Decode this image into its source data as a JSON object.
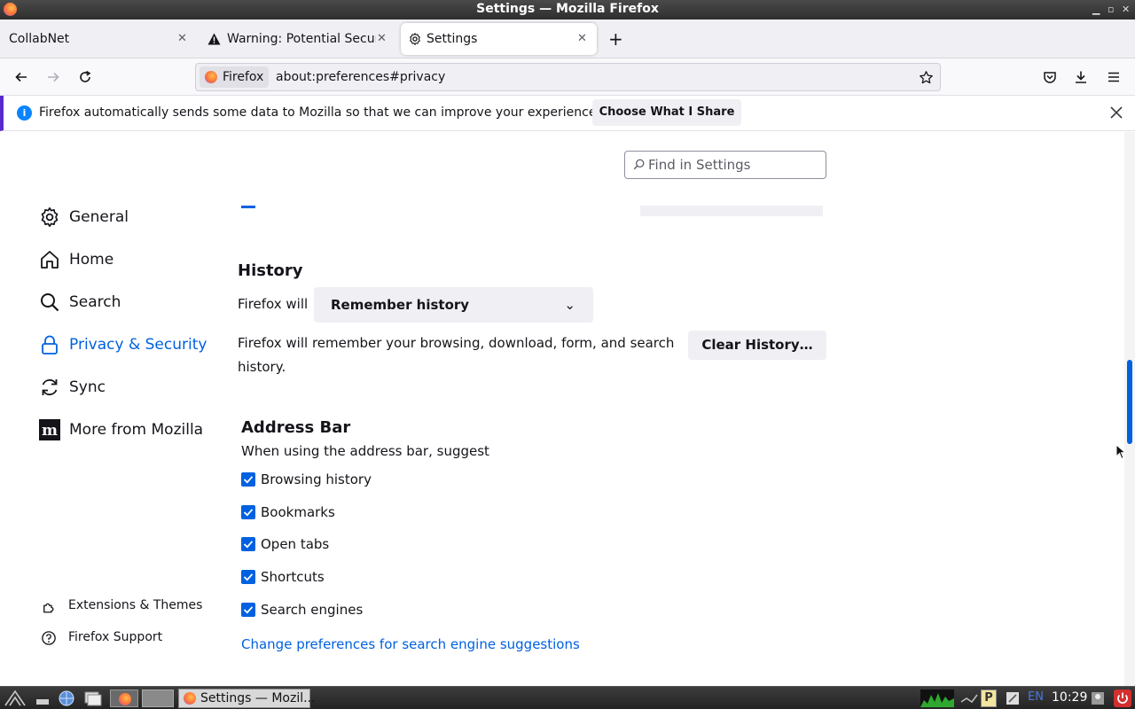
{
  "window": {
    "title": "Settings — Mozilla Firefox"
  },
  "tabs": [
    {
      "label": "CollabNet"
    },
    {
      "label": "Warning: Potential Securi"
    },
    {
      "label": "Settings"
    }
  ],
  "navbar": {
    "identity_label": "Firefox",
    "url": "about:preferences#privacy"
  },
  "notification": {
    "message": "Firefox automatically sends some data to Mozilla so that we can improve your experience.",
    "button_label": "Choose What I Share"
  },
  "search": {
    "placeholder": "Find in Settings"
  },
  "sidebar": {
    "items": [
      {
        "label": "General",
        "icon": "gear-icon"
      },
      {
        "label": "Home",
        "icon": "home-icon"
      },
      {
        "label": "Search",
        "icon": "search-icon"
      },
      {
        "label": "Privacy & Security",
        "icon": "lock-icon",
        "selected": true
      },
      {
        "label": "Sync",
        "icon": "sync-icon"
      },
      {
        "label": "More from Mozilla",
        "icon": "mozilla-icon"
      }
    ],
    "footer": [
      {
        "label": "Extensions & Themes",
        "icon": "puzzle-icon"
      },
      {
        "label": "Firefox Support",
        "icon": "help-icon"
      }
    ]
  },
  "history": {
    "heading": "History",
    "firefox_will_label": "Firefox will",
    "select_value": "Remember history",
    "description": "Firefox will remember your browsing, download, form, and search history.",
    "clear_button": "Clear History…"
  },
  "address_bar": {
    "heading": "Address Bar",
    "subtitle": "When using the address bar, suggest",
    "options": [
      {
        "label": "Browsing history",
        "checked": true
      },
      {
        "label": "Bookmarks",
        "checked": true
      },
      {
        "label": "Open tabs",
        "checked": true
      },
      {
        "label": "Shortcuts",
        "checked": true
      },
      {
        "label": "Search engines",
        "checked": true
      }
    ],
    "link": "Change preferences for search engine suggestions"
  },
  "taskbar": {
    "window_item": "Settings — Mozil...",
    "lang": "EN",
    "clock": "10:29"
  },
  "colors": {
    "accent": "#0061e0",
    "notification_border": "#592acb"
  }
}
